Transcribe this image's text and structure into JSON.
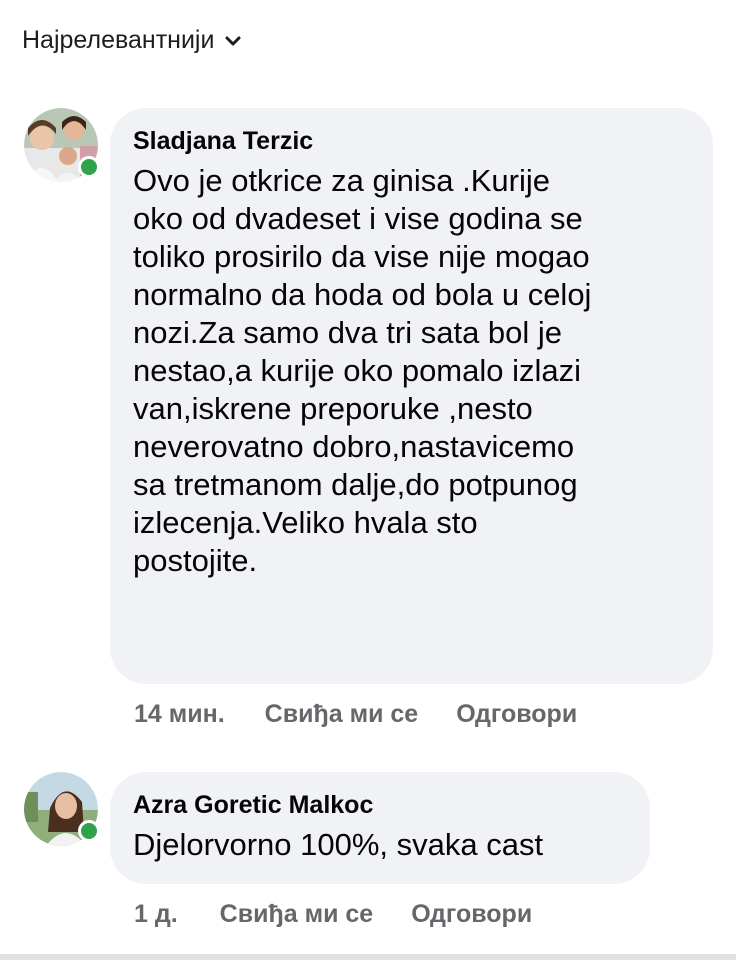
{
  "sort": {
    "label": "Најрелевантнији",
    "icon": "chevron-down-icon"
  },
  "comments": [
    {
      "author": "Sladjana Terzic",
      "lines": [
        "Ovo je otkrice za ginisa .Kurije",
        "oko od dvadeset i vise godina se",
        "toliko prosirilo da vise nije mogao",
        "normalno da hoda od bola u celoj",
        "nozi.Za samo dva tri sata bol je",
        "nestao,a kurije oko pomalo izlazi",
        "van,iskrene preporuke ,nesto",
        "neverovatno dobro,nastavicemo",
        "sa tretmanom dalje,do potpunog",
        "izlecenja.Veliko hvala sto",
        "postojite."
      ],
      "time": "14 мин.",
      "like_label": "Свиђа ми се",
      "reply_label": "Одговори",
      "online": true
    },
    {
      "author": "Azra Goretic Malkoc",
      "lines": [
        "Djelorvorno 100%, svaka cast"
      ],
      "time": "1 д.",
      "like_label": "Свиђа ми се",
      "reply_label": "Одговори",
      "online": true
    }
  ],
  "colors": {
    "bubble": "#f0f2f5",
    "online": "#31a24c",
    "meta": "#65676b"
  }
}
